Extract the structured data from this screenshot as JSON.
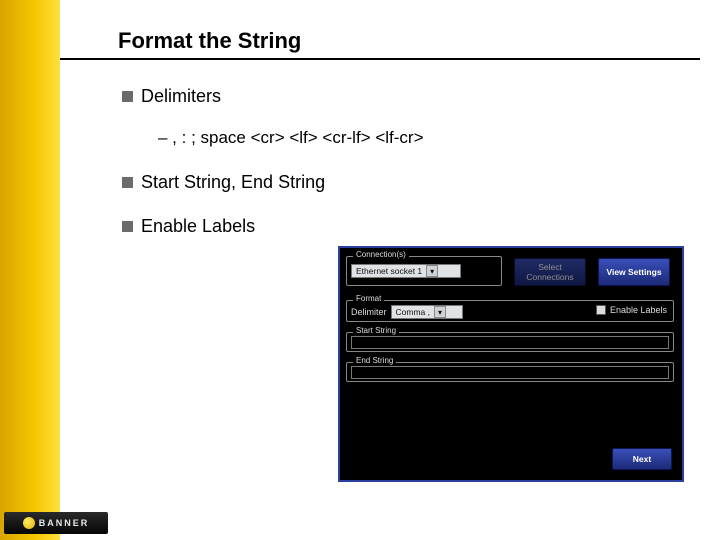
{
  "title": "Format the String",
  "bullets": {
    "b0": "Delimiters",
    "b0_sub": "– , : ; space <cr> <lf> <cr-lf> <lf-cr>",
    "b1": "Start String, End String",
    "b2": "Enable Labels"
  },
  "panel": {
    "group_connections": "Connection(s)",
    "conn_value": "Ethernet socket 1",
    "btn_select": "Select Connections",
    "btn_view": "View Settings",
    "group_format": "Format",
    "delimiter_label": "Delimiter",
    "delimiter_value": "Comma ,",
    "enable_labels": "Enable Labels",
    "start_string": "Start String",
    "end_string": "End String",
    "btn_next": "Next"
  },
  "logo_text": "BANNER"
}
